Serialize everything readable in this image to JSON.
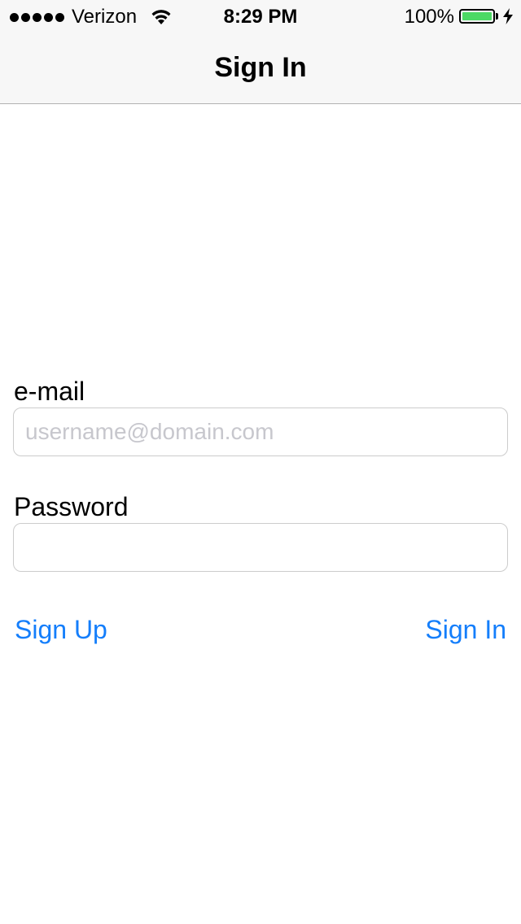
{
  "status_bar": {
    "signal_bars": 5,
    "carrier": "Verizon",
    "time": "8:29 PM",
    "battery_percent_label": "100%",
    "battery_level": 1.0,
    "icons": [
      "signal-dots-icon",
      "wifi-icon",
      "battery-icon",
      "charging-bolt-icon"
    ]
  },
  "nav": {
    "title": "Sign In"
  },
  "form": {
    "email_label": "e-mail",
    "email_value": "",
    "email_placeholder": "username@domain.com",
    "password_label": "Password",
    "password_value": "",
    "password_placeholder": ""
  },
  "actions": {
    "sign_up_label": "Sign Up",
    "sign_in_label": "Sign In"
  },
  "colors": {
    "accent": "#147efb",
    "battery_fill": "#4cd964",
    "nav_background": "#f7f7f7",
    "placeholder": "#c7c7cd"
  }
}
